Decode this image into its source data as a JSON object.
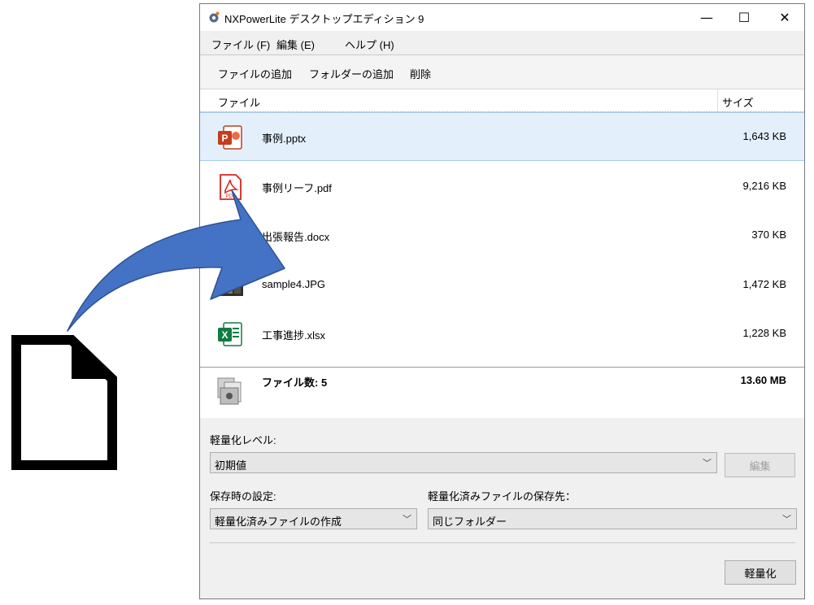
{
  "window": {
    "title": "NXPowerLite デスクトップエディション 9",
    "controls": {
      "minimize": "—",
      "maximize": "☐",
      "close": "✕"
    }
  },
  "menu": {
    "file": "ファイル (F)",
    "edit": "編集 (E)",
    "help": "ヘルプ (H)"
  },
  "toolbar": {
    "add_file": "ファイルの追加",
    "add_folder": "フォルダーの追加",
    "delete": "削除"
  },
  "list": {
    "col_file": "ファイル",
    "col_size": "サイズ",
    "rows": [
      {
        "name": "事例.pptx",
        "size": "1,643 KB",
        "icon": "powerpoint-icon",
        "selected": true
      },
      {
        "name": "事例リーフ.pdf",
        "size": "9,216 KB",
        "icon": "pdf-icon",
        "selected": false
      },
      {
        "name": "出張報告.docx",
        "size": "370 KB",
        "icon": "word-icon",
        "selected": false
      },
      {
        "name": "sample4.JPG",
        "size": "1,472 KB",
        "icon": "image-icon",
        "selected": false
      },
      {
        "name": "工事進捗.xlsx",
        "size": "1,228 KB",
        "icon": "excel-icon",
        "selected": false
      }
    ]
  },
  "summary": {
    "count": "ファイル数: 5",
    "total": "13.60 MB"
  },
  "settings": {
    "level_label": "軽量化レベル:",
    "level_value": "初期値",
    "edit_button": "編集",
    "save_label": "保存時の設定:",
    "save_value": "軽量化済みファイルの作成",
    "dest_label": "軽量化済みファイルの保存先：",
    "dest_value": "同じフォルダー",
    "optimize_button": "軽量化"
  },
  "colors": {
    "arrow_fill": "#4472c4",
    "arrow_stroke": "#2f528f",
    "selected_row": "#e3f0fb",
    "powerpoint": "#c43e1c",
    "pdf": "#d9261c",
    "excel": "#107c41",
    "word": "#2b579a"
  }
}
